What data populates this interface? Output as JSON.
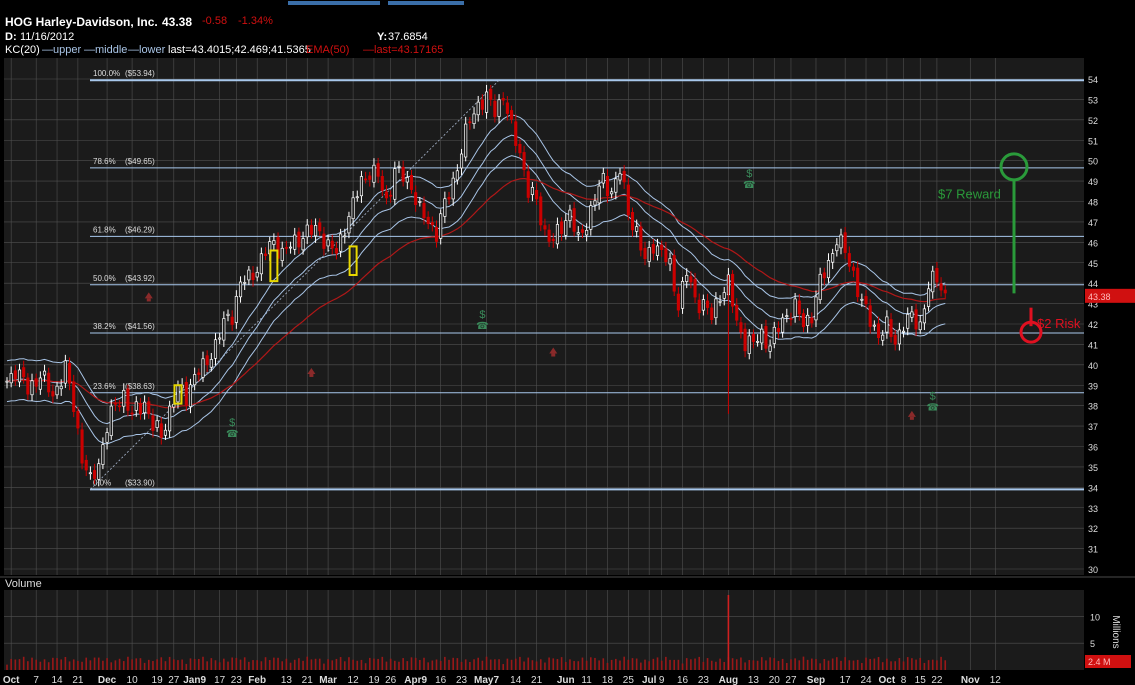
{
  "header": {
    "symbol_name": "HOG Harley-Davidson, Inc.",
    "last": "43.38",
    "change": "-0.58",
    "change_pct": "-1.34%",
    "date_label": "D:",
    "date": "11/16/2012",
    "y_label": "Y:",
    "y_value": "37.6854",
    "kc_text": "KC(20)",
    "kc_upper": "upper",
    "kc_middle": "middle",
    "kc_lower": "lower",
    "kc_last": "last=43.4015;42.469;41.5365",
    "ema_text": "EMA(50)",
    "ema_last": "last=43.17165"
  },
  "colors": {
    "background": "#000000",
    "panel_bg": "#1b1b1b",
    "grid": "#505050",
    "candle_up": "#ffffff",
    "candle_down": "#cc0000",
    "keltner": "#a8c4e6",
    "ema": "#b01818",
    "fib": "#a8c8ec",
    "reward": "#2a9a3a",
    "risk": "#e01020",
    "earnings": "#3a8a5a",
    "dividend": "#8a2a2a",
    "price_tag": "#d01010"
  },
  "chart_data": {
    "type": "candlestick",
    "ylim": [
      30,
      54.5
    ],
    "y_ticks": [
      30,
      31,
      32,
      33,
      34,
      35,
      36,
      37,
      38,
      39,
      40,
      41,
      42,
      43,
      44,
      45,
      46,
      47,
      48,
      49,
      50,
      51,
      52,
      53,
      54
    ],
    "price_tag": "43.38",
    "x_ticks": [
      {
        "label": "Oct",
        "bar": 1
      },
      {
        "label": "7",
        "bar": 7
      },
      {
        "label": "14",
        "bar": 12
      },
      {
        "label": "21",
        "bar": 17
      },
      {
        "label": "Dec",
        "bar": 24
      },
      {
        "label": "10",
        "bar": 30
      },
      {
        "label": "19",
        "bar": 36
      },
      {
        "label": "27",
        "bar": 40
      },
      {
        "label": "Jan9",
        "bar": 45
      },
      {
        "label": "17",
        "bar": 51
      },
      {
        "label": "23",
        "bar": 55
      },
      {
        "label": "Feb",
        "bar": 60
      },
      {
        "label": "13",
        "bar": 67
      },
      {
        "label": "21",
        "bar": 72
      },
      {
        "label": "Mar",
        "bar": 77
      },
      {
        "label": "12",
        "bar": 83
      },
      {
        "label": "19",
        "bar": 88
      },
      {
        "label": "26",
        "bar": 92
      },
      {
        "label": "Apr9",
        "bar": 98
      },
      {
        "label": "16",
        "bar": 104
      },
      {
        "label": "23",
        "bar": 109
      },
      {
        "label": "May7",
        "bar": 115
      },
      {
        "label": "14",
        "bar": 122
      },
      {
        "label": "21",
        "bar": 127
      },
      {
        "label": "Jun",
        "bar": 134
      },
      {
        "label": "11",
        "bar": 139
      },
      {
        "label": "18",
        "bar": 144
      },
      {
        "label": "25",
        "bar": 149
      },
      {
        "label": "Jul",
        "bar": 154
      },
      {
        "label": "9",
        "bar": 157
      },
      {
        "label": "16",
        "bar": 162
      },
      {
        "label": "23",
        "bar": 167
      },
      {
        "label": "Aug",
        "bar": 173
      },
      {
        "label": "13",
        "bar": 179
      },
      {
        "label": "20",
        "bar": 184
      },
      {
        "label": "27",
        "bar": 188
      },
      {
        "label": "Sep",
        "bar": 194
      },
      {
        "label": "17",
        "bar": 201
      },
      {
        "label": "24",
        "bar": 206
      },
      {
        "label": "Oct",
        "bar": 211
      },
      {
        "label": "8",
        "bar": 215
      },
      {
        "label": "15",
        "bar": 219
      },
      {
        "label": "22",
        "bar": 223
      },
      {
        "label": "Nov",
        "bar": 231
      },
      {
        "label": "12",
        "bar": 237
      }
    ],
    "fib_levels": [
      {
        "label": "100.0%",
        "price_label": "($53.94)",
        "value": 53.94
      },
      {
        "label": "78.6%",
        "price_label": "($49.65)",
        "value": 49.65
      },
      {
        "label": "61.8%",
        "price_label": "($46.29)",
        "value": 46.29
      },
      {
        "label": "50.0%",
        "price_label": "($43.92)",
        "value": 43.92
      },
      {
        "label": "38.2%",
        "price_label": "($41.56)",
        "value": 41.56
      },
      {
        "label": "23.6%",
        "price_label": "($38.63)",
        "value": 38.63
      },
      {
        "label": "0.0%",
        "price_label": "($33.90)",
        "value": 33.9
      }
    ],
    "anchors": [
      [
        0,
        39.2
      ],
      [
        2,
        39.8
      ],
      [
        5,
        38.8
      ],
      [
        8,
        39.5
      ],
      [
        11,
        38.5
      ],
      [
        14,
        39.8
      ],
      [
        16,
        38.0
      ],
      [
        18,
        35.5
      ],
      [
        20,
        34.2
      ],
      [
        22,
        35.2
      ],
      [
        24,
        37.0
      ],
      [
        26,
        38.0
      ],
      [
        28,
        38.6
      ],
      [
        30,
        37.5
      ],
      [
        33,
        38.2
      ],
      [
        35,
        37.0
      ],
      [
        37,
        36.5
      ],
      [
        39,
        37.8
      ],
      [
        41,
        38.8
      ],
      [
        43,
        38.5
      ],
      [
        45,
        39.5
      ],
      [
        47,
        39.8
      ],
      [
        50,
        41.0
      ],
      [
        52,
        42.0
      ],
      [
        54,
        42.5
      ],
      [
        56,
        44.0
      ],
      [
        58,
        44.2
      ],
      [
        60,
        44.8
      ],
      [
        62,
        45.5
      ],
      [
        64,
        46.0
      ],
      [
        66,
        45.5
      ],
      [
        68,
        45.8
      ],
      [
        70,
        46.2
      ],
      [
        72,
        46.5
      ],
      [
        75,
        46.6
      ],
      [
        77,
        45.8
      ],
      [
        79,
        45.5
      ],
      [
        81,
        46.8
      ],
      [
        83,
        47.8
      ],
      [
        85,
        49.0
      ],
      [
        87,
        49.5
      ],
      [
        89,
        49.2
      ],
      [
        91,
        48.0
      ],
      [
        93,
        49.5
      ],
      [
        95,
        49.2
      ],
      [
        97,
        48.8
      ],
      [
        99,
        47.5
      ],
      [
        101,
        47.0
      ],
      [
        103,
        46.5
      ],
      [
        105,
        47.8
      ],
      [
        107,
        49.0
      ],
      [
        109,
        50.5
      ],
      [
        111,
        52.0
      ],
      [
        113,
        52.8
      ],
      [
        115,
        53.0
      ],
      [
        117,
        52.5
      ],
      [
        119,
        53.2
      ],
      [
        121,
        51.5
      ],
      [
        123,
        50.5
      ],
      [
        125,
        48.5
      ],
      [
        127,
        48.0
      ],
      [
        129,
        46.5
      ],
      [
        131,
        46.0
      ],
      [
        133,
        46.8
      ],
      [
        135,
        47.5
      ],
      [
        137,
        46.0
      ],
      [
        139,
        47.0
      ],
      [
        141,
        48.2
      ],
      [
        143,
        49.0
      ],
      [
        145,
        48.5
      ],
      [
        147,
        49.5
      ],
      [
        149,
        47.5
      ],
      [
        151,
        46.5
      ],
      [
        153,
        45.0
      ],
      [
        155,
        46.0
      ],
      [
        157,
        45.5
      ],
      [
        159,
        44.8
      ],
      [
        161,
        43.0
      ],
      [
        163,
        44.5
      ],
      [
        165,
        43.2
      ],
      [
        167,
        43.0
      ],
      [
        169,
        42.3
      ],
      [
        171,
        43.5
      ],
      [
        173,
        44.0
      ],
      [
        175,
        42.0
      ],
      [
        177,
        41.2
      ],
      [
        179,
        41.0
      ],
      [
        181,
        41.5
      ],
      [
        183,
        41.0
      ],
      [
        185,
        41.8
      ],
      [
        187,
        42.5
      ],
      [
        189,
        42.8
      ],
      [
        191,
        42.0
      ],
      [
        193,
        42.5
      ],
      [
        195,
        44.0
      ],
      [
        197,
        45.0
      ],
      [
        199,
        46.2
      ],
      [
        201,
        45.5
      ],
      [
        203,
        44.5
      ],
      [
        205,
        43.0
      ],
      [
        207,
        42.2
      ],
      [
        209,
        41.5
      ],
      [
        211,
        41.8
      ],
      [
        213,
        41.2
      ],
      [
        215,
        42.0
      ],
      [
        217,
        42.3
      ],
      [
        219,
        42.0
      ],
      [
        221,
        43.8
      ],
      [
        223,
        44.3
      ],
      [
        225,
        43.4
      ]
    ],
    "spikes": [
      {
        "bar": 173,
        "low": 37.6
      }
    ],
    "highlight_boxes": [
      {
        "bar": 41,
        "low": 38.1,
        "high": 39.0
      },
      {
        "bar": 64,
        "low": 44.1,
        "high": 45.6
      },
      {
        "bar": 83,
        "low": 44.4,
        "high": 45.8
      }
    ],
    "earnings_markers": [
      {
        "bar": 54,
        "price": 37.0
      },
      {
        "bar": 114,
        "price": 42.3
      },
      {
        "bar": 178,
        "price": 49.2
      },
      {
        "bar": 222,
        "price": 38.3
      }
    ],
    "dividend_markers": [
      {
        "bar": 34,
        "price": 43.4
      },
      {
        "bar": 73,
        "price": 39.7
      },
      {
        "bar": 131,
        "price": 40.7
      },
      {
        "bar": 217,
        "price": 37.6
      }
    ],
    "reward_label": "$7 Reward",
    "risk_label": "$2 Risk",
    "reward_from": 43.5,
    "reward_to": 49.6,
    "risk_from": 43.5,
    "risk_to": 41.6,
    "volume": {
      "label": "Volume",
      "unit_label": "Millions",
      "ylim": [
        0,
        14
      ],
      "ticks": [
        5,
        10
      ],
      "value_tag": "2.4 M",
      "spike_bar": 173,
      "spike_value": 14
    }
  }
}
